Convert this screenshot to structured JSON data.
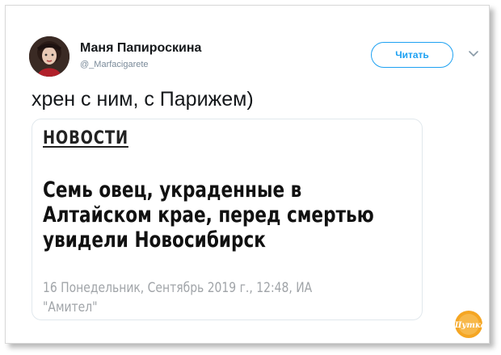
{
  "author": {
    "display_name": "Маня Папироскина",
    "handle": "@_Marfacigarete",
    "avatar_icon": "user-avatar"
  },
  "follow_button": {
    "label": "Читать"
  },
  "menu_icon": "chevron-down-icon",
  "tweet": {
    "text": "хрен с ним, с Парижем)"
  },
  "card": {
    "section": "НОВОСТИ",
    "headline_lines": [
      "Семь овец, украденные в",
      "Алтайском крае, перед смертью",
      "увидели Новосибирск"
    ],
    "meta_lines": [
      "16 Понедельник, Сентябрь 2019 г., 12:48, ИА",
      "\"Амител\""
    ]
  },
  "watermark": {
    "text": "Шутка"
  },
  "colors": {
    "accent": "#1da1f2",
    "text": "#14171a",
    "muted": "#7a8a99",
    "card_border": "#e1e8ed",
    "meta": "#a0a4a8",
    "watermark": "#f5a623"
  }
}
